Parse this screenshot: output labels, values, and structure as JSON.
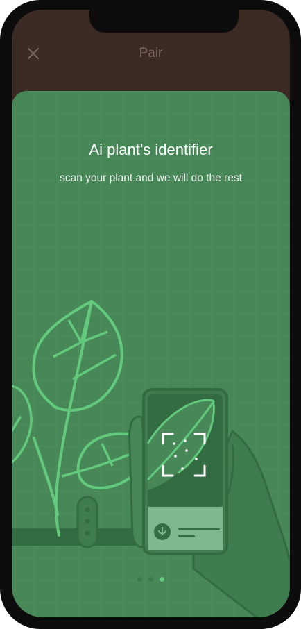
{
  "header": {
    "title": "Pair",
    "close_icon": "close-icon"
  },
  "onboarding": {
    "title": "Ai plant’s identifier",
    "subtitle": "scan your plant and we will do the rest",
    "illustration": "plant-scan-illustration"
  },
  "pagination": {
    "total_pages": 3,
    "current_page": 3
  },
  "colors": {
    "frame": "#0c0c0c",
    "header_background": "#3c2a24",
    "card_background": "#478758",
    "accent_green": "#63c97c",
    "dark_green": "#336b43"
  }
}
